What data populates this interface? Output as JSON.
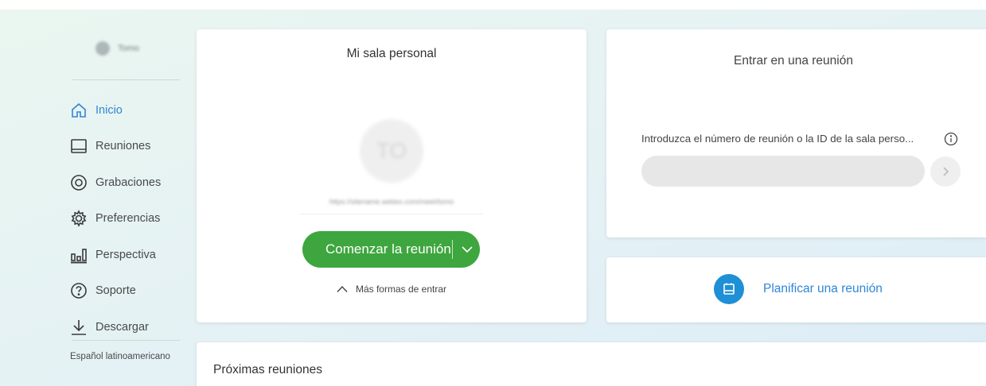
{
  "user": {
    "name": "Tomo"
  },
  "sidebar": {
    "items": [
      {
        "label": "Inicio",
        "icon": "home-icon",
        "active": true
      },
      {
        "label": "Reuniones",
        "icon": "calendar-icon"
      },
      {
        "label": "Grabaciones",
        "icon": "recording-icon"
      },
      {
        "label": "Preferencias",
        "icon": "gear-icon"
      },
      {
        "label": "Perspectiva",
        "icon": "bar-chart-icon"
      },
      {
        "label": "Soporte",
        "icon": "help-icon"
      },
      {
        "label": "Descargar",
        "icon": "download-icon"
      }
    ],
    "language": "Español latinoamericano"
  },
  "personal_room": {
    "title": "Mi sala personal",
    "avatar_initials": "TO",
    "room_url": "https://sitename.webex.com/meet/tomo",
    "start_label": "Comenzar la reunión",
    "more_ways_label": "Más formas de entrar"
  },
  "join": {
    "title": "Entrar en una reunión",
    "input_label": "Introduzca el número de reunión o la ID de la sala perso...",
    "input_value": "",
    "input_placeholder": ""
  },
  "schedule": {
    "label": "Planificar una reunión"
  },
  "upcoming": {
    "title": "Próximas reuniones"
  },
  "colors": {
    "accent_green": "#3ea63e",
    "accent_blue": "#2f86d6",
    "schedule_icon_bg": "#1f8fd6"
  }
}
